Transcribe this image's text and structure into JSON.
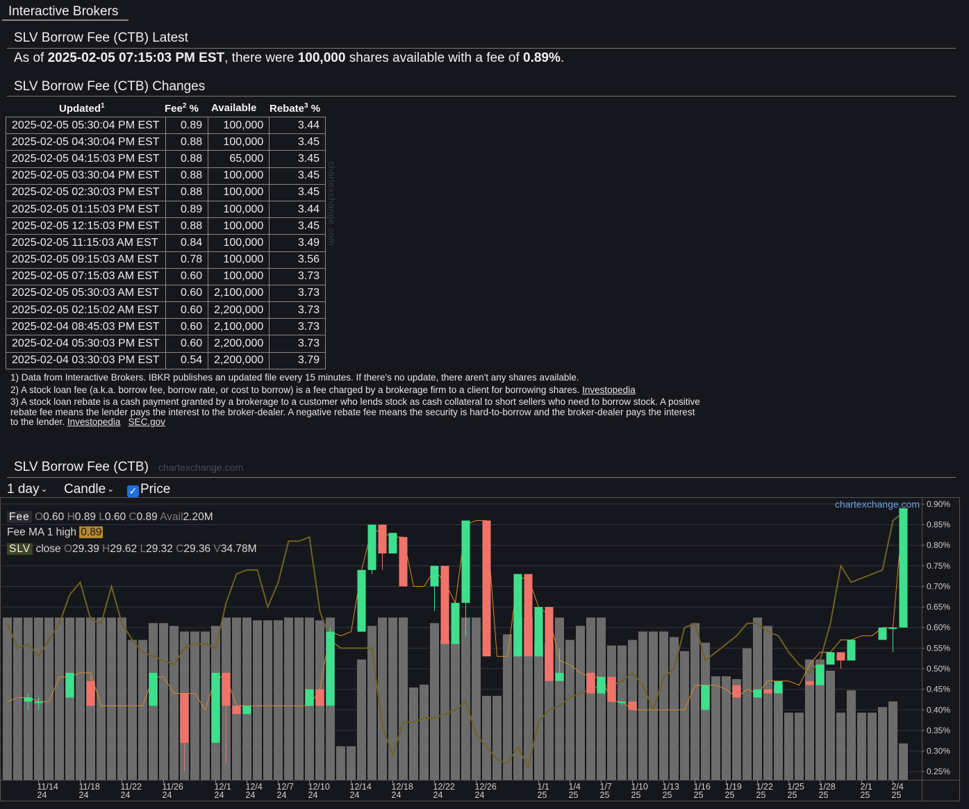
{
  "tab": {
    "label": "Interactive Brokers"
  },
  "latest": {
    "title": "SLV Borrow Fee (CTB) Latest",
    "prefix": "As of ",
    "timestamp": "2025-02-05 07:15:03 PM EST",
    "mid": ", there were ",
    "shares": "100,000",
    "mid2": " shares available with a fee of ",
    "fee": "0.89%",
    "suffix": "."
  },
  "changes": {
    "title": "SLV Borrow Fee (CTB) Changes",
    "headers": {
      "updated": "Updated",
      "fee": "Fee",
      "available": "Available",
      "rebate": "Rebate",
      "pct": " %",
      "sup1": "1",
      "sup2": "2",
      "sup3": "3"
    },
    "rows": [
      [
        "2025-02-05 05:30:04 PM EST",
        "0.89",
        "100,000",
        "3.44"
      ],
      [
        "2025-02-05 04:30:04 PM EST",
        "0.88",
        "100,000",
        "3.45"
      ],
      [
        "2025-02-05 04:15:03 PM EST",
        "0.88",
        "65,000",
        "3.45"
      ],
      [
        "2025-02-05 03:30:04 PM EST",
        "0.88",
        "100,000",
        "3.45"
      ],
      [
        "2025-02-05 02:30:03 PM EST",
        "0.88",
        "100,000",
        "3.45"
      ],
      [
        "2025-02-05 01:15:03 PM EST",
        "0.89",
        "100,000",
        "3.44"
      ],
      [
        "2025-02-05 12:15:03 PM EST",
        "0.88",
        "100,000",
        "3.45"
      ],
      [
        "2025-02-05 11:15:03 AM EST",
        "0.84",
        "100,000",
        "3.49"
      ],
      [
        "2025-02-05 09:15:03 AM EST",
        "0.78",
        "100,000",
        "3.56"
      ],
      [
        "2025-02-05 07:15:03 AM EST",
        "0.60",
        "100,000",
        "3.73"
      ],
      [
        "2025-02-05 05:30:03 AM EST",
        "0.60",
        "2,100,000",
        "3.73"
      ],
      [
        "2025-02-05 02:15:02 AM EST",
        "0.60",
        "2,200,000",
        "3.73"
      ],
      [
        "2025-02-04 08:45:03 PM EST",
        "0.60",
        "2,100,000",
        "3.73"
      ],
      [
        "2025-02-04 05:30:03 PM EST",
        "0.60",
        "2,200,000",
        "3.73"
      ],
      [
        "2025-02-04 03:30:03 PM EST",
        "0.54",
        "2,200,000",
        "3.79"
      ]
    ],
    "watermark": "chartexchange.com"
  },
  "notes": {
    "n1": "1) Data from Interactive Brokers. IBKR publishes an updated file every 15 minutes. If there's no update, there aren't any shares available.",
    "n2": "2) A stock loan fee (a.k.a. borrow fee, borrow rate, or cost to borrow) is a fee charged by a brokerage firm to a client for borrowing shares. ",
    "n2_link": "Investopedia",
    "n3": "3) A stock loan rebate is a cash payment granted by a brokerage to a customer who lends stock as cash collateral to short sellers who need to borrow stock. A positive rebate fee means the lender pays the interest to the broker-dealer. A negative rebate fee means the security is hard-to-borrow and the broker-dealer pays the interest to the lender. ",
    "n3_link1": "Investopedia",
    "n3_link2": "SEC.gov"
  },
  "chart_section": {
    "title": "SLV Borrow Fee (CTB)",
    "watermark": "chartexchange.com",
    "interval": "1 day",
    "style": "Candle",
    "price_label": "Price",
    "price_checked": true,
    "source": "chartexchange.com"
  },
  "legend": {
    "fee_tag": "Fee",
    "fee_o_k": "O",
    "fee_o": "0.60",
    "fee_h_k": "H",
    "fee_h": "0.89",
    "fee_l_k": "L",
    "fee_l": "0.60",
    "fee_c_k": "C",
    "fee_c": "0.89",
    "fee_a_k": "Avail",
    "fee_a": "2.20M",
    "ma_label": "Fee MA 1 high ",
    "ma_value": "0.89",
    "slv_tag": "SLV",
    "slv_label": " close ",
    "slv_o_k": "O",
    "slv_o": "29.39",
    "slv_h_k": "H",
    "slv_h": "29.62",
    "slv_l_k": "L",
    "slv_l": "29.32",
    "slv_c_k": "C",
    "slv_c": "29.36",
    "slv_v_k": "V",
    "slv_v": "34.78M"
  },
  "colors": {
    "up": "#3ee08d",
    "down": "#f0736a",
    "volume": "#6c6c6c",
    "price_line": "#6b6325",
    "ma_line": "#d98a2a",
    "bg": "#16171c",
    "accent": "#6aa0e8"
  },
  "chart_data": {
    "type": "candlestick",
    "y_ticks": [
      "0.90%",
      "0.85%",
      "0.80%",
      "0.75%",
      "0.70%",
      "0.65%",
      "0.60%",
      "0.55%",
      "0.50%",
      "0.45%",
      "0.40%",
      "0.35%",
      "0.30%",
      "0.25%"
    ],
    "ylim": [
      0.23,
      0.91
    ],
    "x_ticks": [
      {
        "i": 3,
        "top": "11/14",
        "bot": "24"
      },
      {
        "i": 7,
        "top": "11/18",
        "bot": "24"
      },
      {
        "i": 11,
        "top": "11/22",
        "bot": "24"
      },
      {
        "i": 15,
        "top": "11/26",
        "bot": "24"
      },
      {
        "i": 20,
        "top": "12/1",
        "bot": "24"
      },
      {
        "i": 23,
        "top": "12/4",
        "bot": "24"
      },
      {
        "i": 26,
        "top": "12/7",
        "bot": "24"
      },
      {
        "i": 29,
        "top": "12/10",
        "bot": "24"
      },
      {
        "i": 33,
        "top": "12/14",
        "bot": "24"
      },
      {
        "i": 37,
        "top": "12/18",
        "bot": "24"
      },
      {
        "i": 41,
        "top": "12/22",
        "bot": "24"
      },
      {
        "i": 45,
        "top": "12/26",
        "bot": "24"
      },
      {
        "i": 51,
        "top": "1/1",
        "bot": "25"
      },
      {
        "i": 54,
        "top": "1/4",
        "bot": "25"
      },
      {
        "i": 57,
        "top": "1/7",
        "bot": "25"
      },
      {
        "i": 60,
        "top": "1/10",
        "bot": "25"
      },
      {
        "i": 63,
        "top": "1/13",
        "bot": "25"
      },
      {
        "i": 66,
        "top": "1/16",
        "bot": "25"
      },
      {
        "i": 69,
        "top": "1/19",
        "bot": "25"
      },
      {
        "i": 72,
        "top": "1/22",
        "bot": "25"
      },
      {
        "i": 75,
        "top": "1/25",
        "bot": "25"
      },
      {
        "i": 78,
        "top": "1/28",
        "bot": "25"
      },
      {
        "i": 82,
        "top": "2/1",
        "bot": "25"
      },
      {
        "i": 85,
        "top": "2/4",
        "bot": "25"
      }
    ],
    "fee_candles": [
      {
        "i": 2,
        "o": 0.42,
        "h": 0.44,
        "l": 0.4,
        "c": 0.43
      },
      {
        "i": 3,
        "o": 0.42,
        "h": 0.43,
        "l": 0.4,
        "c": 0.42
      },
      {
        "i": 6,
        "o": 0.43,
        "h": 0.49,
        "l": 0.43,
        "c": 0.49
      },
      {
        "i": 8,
        "o": 0.47,
        "h": 0.48,
        "l": 0.41,
        "c": 0.41
      },
      {
        "i": 14,
        "o": 0.41,
        "h": 0.49,
        "l": 0.41,
        "c": 0.49
      },
      {
        "i": 17,
        "o": 0.44,
        "h": 0.44,
        "l": 0.25,
        "c": 0.32
      },
      {
        "i": 20,
        "o": 0.32,
        "h": 0.49,
        "l": 0.32,
        "c": 0.49
      },
      {
        "i": 21,
        "o": 0.49,
        "h": 0.49,
        "l": 0.27,
        "c": 0.41
      },
      {
        "i": 22,
        "o": 0.41,
        "h": 0.41,
        "l": 0.39,
        "c": 0.39
      },
      {
        "i": 23,
        "o": 0.39,
        "h": 0.41,
        "l": 0.39,
        "c": 0.41
      },
      {
        "i": 29,
        "o": 0.41,
        "h": 0.45,
        "l": 0.41,
        "c": 0.45
      },
      {
        "i": 30,
        "o": 0.45,
        "h": 0.45,
        "l": 0.41,
        "c": 0.41
      },
      {
        "i": 31,
        "o": 0.41,
        "h": 0.6,
        "l": 0.41,
        "c": 0.59
      },
      {
        "i": 34,
        "o": 0.59,
        "h": 0.74,
        "l": 0.59,
        "c": 0.74
      },
      {
        "i": 35,
        "o": 0.74,
        "h": 0.85,
        "l": 0.73,
        "c": 0.85
      },
      {
        "i": 36,
        "o": 0.85,
        "h": 0.85,
        "l": 0.74,
        "c": 0.78
      },
      {
        "i": 37,
        "o": 0.78,
        "h": 0.83,
        "l": 0.78,
        "c": 0.83
      },
      {
        "i": 38,
        "o": 0.82,
        "h": 0.82,
        "l": 0.7,
        "c": 0.7
      },
      {
        "i": 41,
        "o": 0.7,
        "h": 0.75,
        "l": 0.64,
        "c": 0.75
      },
      {
        "i": 42,
        "o": 0.75,
        "h": 0.75,
        "l": 0.56,
        "c": 0.56
      },
      {
        "i": 43,
        "o": 0.56,
        "h": 0.66,
        "l": 0.56,
        "c": 0.66
      },
      {
        "i": 44,
        "o": 0.66,
        "h": 0.86,
        "l": 0.58,
        "c": 0.86
      },
      {
        "i": 46,
        "o": 0.86,
        "h": 0.86,
        "l": 0.53,
        "c": 0.53
      },
      {
        "i": 49,
        "o": 0.53,
        "h": 0.73,
        "l": 0.53,
        "c": 0.73
      },
      {
        "i": 50,
        "o": 0.73,
        "h": 0.73,
        "l": 0.53,
        "c": 0.53
      },
      {
        "i": 51,
        "o": 0.53,
        "h": 0.65,
        "l": 0.53,
        "c": 0.65
      },
      {
        "i": 52,
        "o": 0.65,
        "h": 0.65,
        "l": 0.47,
        "c": 0.47
      },
      {
        "i": 53,
        "o": 0.47,
        "h": 0.55,
        "l": 0.47,
        "c": 0.49
      },
      {
        "i": 56,
        "o": 0.49,
        "h": 0.49,
        "l": 0.44,
        "c": 0.44
      },
      {
        "i": 57,
        "o": 0.44,
        "h": 0.48,
        "l": 0.44,
        "c": 0.48
      },
      {
        "i": 58,
        "o": 0.48,
        "h": 0.48,
        "l": 0.42,
        "c": 0.42
      },
      {
        "i": 59,
        "o": 0.42,
        "h": 0.42,
        "l": 0.41,
        "c": 0.42
      },
      {
        "i": 60,
        "o": 0.42,
        "h": 0.42,
        "l": 0.4,
        "c": 0.4
      },
      {
        "i": 67,
        "o": 0.4,
        "h": 0.46,
        "l": 0.4,
        "c": 0.46
      },
      {
        "i": 70,
        "o": 0.46,
        "h": 0.46,
        "l": 0.43,
        "c": 0.43
      },
      {
        "i": 72,
        "o": 0.43,
        "h": 0.45,
        "l": 0.43,
        "c": 0.45
      },
      {
        "i": 73,
        "o": 0.45,
        "h": 0.45,
        "l": 0.44,
        "c": 0.44
      },
      {
        "i": 74,
        "o": 0.44,
        "h": 0.47,
        "l": 0.44,
        "c": 0.47
      },
      {
        "i": 77,
        "o": 0.47,
        "h": 0.47,
        "l": 0.46,
        "c": 0.46
      },
      {
        "i": 78,
        "o": 0.46,
        "h": 0.51,
        "l": 0.46,
        "c": 0.51
      },
      {
        "i": 79,
        "o": 0.51,
        "h": 0.54,
        "l": 0.51,
        "c": 0.54
      },
      {
        "i": 80,
        "o": 0.54,
        "h": 0.54,
        "l": 0.5,
        "c": 0.52
      },
      {
        "i": 81,
        "o": 0.52,
        "h": 0.57,
        "l": 0.52,
        "c": 0.57
      },
      {
        "i": 84,
        "o": 0.57,
        "h": 0.6,
        "l": 0.57,
        "c": 0.6
      },
      {
        "i": 85,
        "o": 0.6,
        "h": 0.6,
        "l": 0.54,
        "c": 0.6
      },
      {
        "i": 86,
        "o": 0.6,
        "h": 0.89,
        "l": 0.6,
        "c": 0.89
      }
    ],
    "volume_pct": [
      0.58,
      0.58,
      0.58,
      0.58,
      0.58,
      0.58,
      0.58,
      0.58,
      0.58,
      0.58,
      0.58,
      0.58,
      0.5,
      0.5,
      0.56,
      0.56,
      0.55,
      0.53,
      0.53,
      0.53,
      0.55,
      0.58,
      0.58,
      0.58,
      0.57,
      0.57,
      0.57,
      0.58,
      0.58,
      0.58,
      0.57,
      0.58,
      0.12,
      0.12,
      0.43,
      0.55,
      0.58,
      0.58,
      0.58,
      0.33,
      0.34,
      0.56,
      0.5,
      0.49,
      0.58,
      0.58,
      0.3,
      0.3,
      0.52,
      0.58,
      0.58,
      0.49,
      0.49,
      0.58,
      0.5,
      0.55,
      0.58,
      0.58,
      0.48,
      0.48,
      0.5,
      0.53,
      0.53,
      0.53,
      0.51,
      0.46,
      0.56,
      0.49,
      0.37,
      0.37,
      0.36,
      0.47,
      0.58,
      0.55,
      0.34,
      0.24,
      0.24,
      0.43,
      0.43,
      0.39,
      0.24,
      0.32,
      0.24,
      0.24,
      0.26,
      0.28,
      0.13
    ],
    "price_line": [
      0.61,
      0.55,
      0.56,
      0.53,
      0.57,
      0.61,
      0.68,
      0.71,
      0.62,
      0.61,
      0.7,
      0.61,
      0.57,
      0.54,
      0.53,
      0.52,
      0.51,
      0.55,
      0.56,
      0.56,
      0.55,
      0.66,
      0.73,
      0.74,
      0.74,
      0.65,
      0.71,
      0.81,
      0.81,
      0.82,
      0.64,
      0.57,
      0.55,
      0.55,
      0.55,
      0.55,
      0.36,
      0.29,
      0.37,
      0.37,
      0.38,
      0.38,
      0.39,
      0.4,
      0.42,
      0.34,
      0.31,
      0.28,
      0.27,
      0.31,
      0.26,
      0.37,
      0.4,
      0.41,
      0.43,
      0.44,
      0.45,
      0.46,
      0.46,
      0.47,
      0.49,
      0.46,
      0.4,
      0.48,
      0.5,
      0.6,
      0.61,
      0.52,
      0.54,
      0.56,
      0.58,
      0.61,
      0.61,
      0.59,
      0.58,
      0.54,
      0.51,
      0.49,
      0.52,
      0.61,
      0.75,
      0.71,
      0.72,
      0.73,
      0.74,
      0.86,
      0.88
    ],
    "ma_line": [
      0.42,
      0.43,
      0.43,
      0.42,
      0.42,
      0.48,
      0.48,
      0.49,
      0.49,
      0.41,
      0.41,
      0.41,
      0.41,
      0.41,
      0.48,
      0.48,
      0.44,
      0.44,
      0.44,
      0.4,
      0.48,
      0.48,
      0.41,
      0.41,
      0.41,
      0.41,
      0.41,
      0.41,
      0.41,
      0.41,
      0.45,
      0.59,
      0.58,
      0.59,
      0.74,
      0.84,
      0.83,
      0.82,
      0.82,
      0.7,
      0.7,
      0.74,
      0.71,
      0.66,
      0.85,
      0.86,
      0.86,
      0.53,
      0.53,
      0.72,
      0.72,
      0.65,
      0.63,
      0.52,
      0.51,
      0.49,
      0.48,
      0.48,
      0.42,
      0.42,
      0.4,
      0.4,
      0.4,
      0.4,
      0.4,
      0.4,
      0.46,
      0.46,
      0.46,
      0.45,
      0.43,
      0.45,
      0.44,
      0.47,
      0.47,
      0.47,
      0.46,
      0.51,
      0.54,
      0.54,
      0.57,
      0.57,
      0.58,
      0.58,
      0.6,
      0.6,
      0.89
    ]
  }
}
